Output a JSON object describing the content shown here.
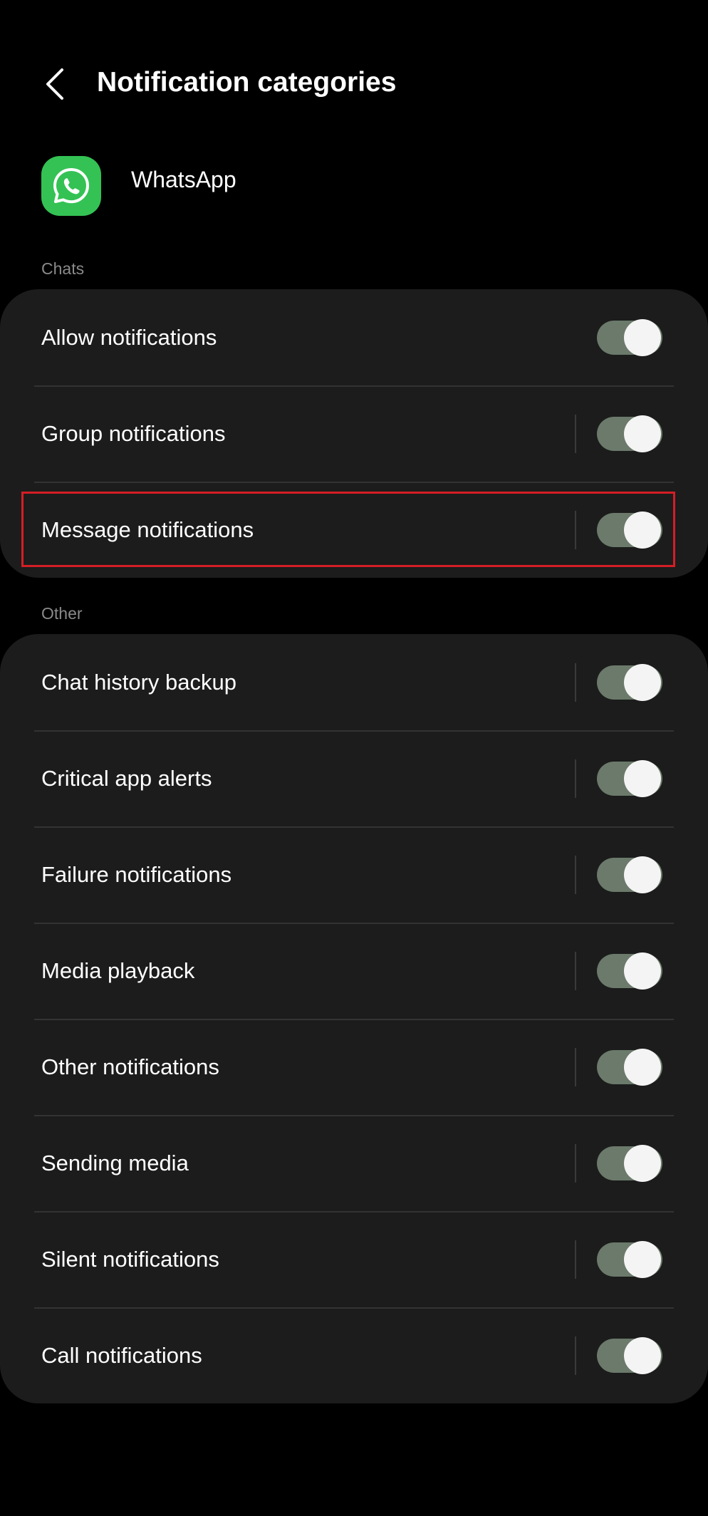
{
  "header": {
    "title": "Notification categories",
    "back_icon": "chevron-left-icon"
  },
  "app": {
    "name": "WhatsApp",
    "icon": "whatsapp-logo-icon",
    "icon_color": "#34c254"
  },
  "sections": {
    "chats": {
      "label": "Chats",
      "items": [
        {
          "label": "Allow notifications",
          "enabled": true
        },
        {
          "label": "Group notifications",
          "enabled": true
        },
        {
          "label": "Message notifications",
          "enabled": true
        }
      ]
    },
    "other": {
      "label": "Other",
      "items": [
        {
          "label": "Chat history backup",
          "enabled": true
        },
        {
          "label": "Critical app alerts",
          "enabled": true
        },
        {
          "label": "Failure notifications",
          "enabled": true
        },
        {
          "label": "Media playback",
          "enabled": true
        },
        {
          "label": "Other notifications",
          "enabled": true
        },
        {
          "label": "Sending media",
          "enabled": true
        },
        {
          "label": "Silent notifications",
          "enabled": true
        },
        {
          "label": "Call notifications",
          "enabled": true
        }
      ]
    }
  },
  "colors": {
    "background": "#000000",
    "card": "#1c1c1c",
    "toggle_track_on": "#6b7a6b",
    "toggle_knob": "#f4f4f4",
    "highlight_border": "#d41e25",
    "section_label": "#8a8a8a"
  }
}
